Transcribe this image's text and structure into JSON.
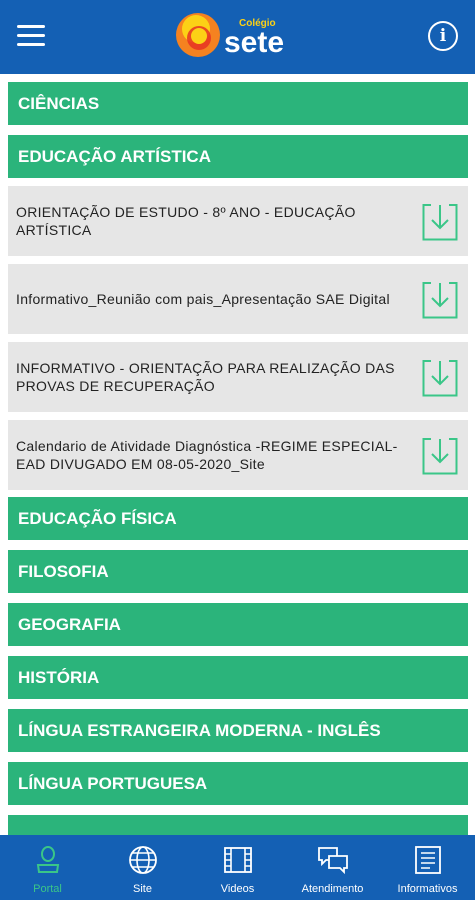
{
  "header": {
    "logo_small": "Colégio",
    "logo_big": "sete",
    "info_label": "i"
  },
  "subjects_top": [
    {
      "label": "CIÊNCIAS"
    },
    {
      "label": "EDUCAÇÃO ARTÍSTICA"
    }
  ],
  "documents": [
    {
      "title": "ORIENTAÇÃO DE ESTUDO - 8º ANO -  EDUCAÇÃO ARTÍSTICA"
    },
    {
      "title": "Informativo_Reunião com pais_Apresentação SAE Digital"
    },
    {
      "title": "INFORMATIVO - ORIENTAÇÃO PARA REALIZAÇÃO DAS PROVAS DE RECUPERAÇÃO"
    },
    {
      "title": "Calendario de Atividade Diagnóstica -REGIME ESPECIAL- EAD  DIVUGADO EM 08-05-2020_Site"
    }
  ],
  "subjects_bottom": [
    {
      "label": "EDUCAÇÃO FÍSICA"
    },
    {
      "label": "FILOSOFIA"
    },
    {
      "label": "GEOGRAFIA"
    },
    {
      "label": "HISTÓRIA"
    },
    {
      "label": "LÍNGUA ESTRANGEIRA MODERNA - INGLÊS"
    },
    {
      "label": "LÍNGUA PORTUGUESA"
    }
  ],
  "bottom_nav": [
    {
      "label": "Portal",
      "icon": "person-icon",
      "active": true
    },
    {
      "label": "Site",
      "icon": "globe-icon"
    },
    {
      "label": "Videos",
      "icon": "film-icon"
    },
    {
      "label": "Atendimento",
      "icon": "chat-icon"
    },
    {
      "label": "Informativos",
      "icon": "document-icon"
    }
  ],
  "colors": {
    "header": "#1460b4",
    "subject_bar": "#2bb47b",
    "active_nav": "#3ac688",
    "document_bg": "#e6e6e6"
  }
}
